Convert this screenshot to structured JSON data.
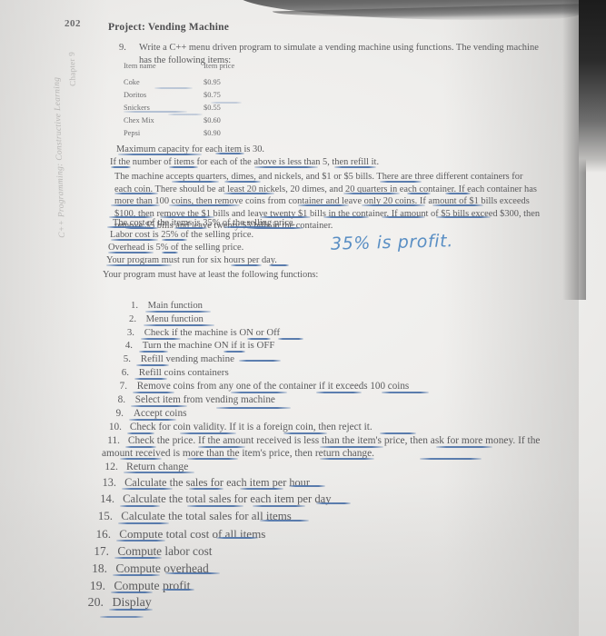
{
  "page": {
    "number": "202",
    "book_margin_text": "C++ Programming: Constructive Learning",
    "chapter_margin_text": "Chapter 9"
  },
  "title": "Project: Vending Machine",
  "question": {
    "number": "9.",
    "text": "Write a C++ menu driven program to simulate a vending machine using functions. The vending machine has the following items:"
  },
  "item_table": {
    "headers": [
      "Item name",
      "Item price"
    ],
    "rows": [
      [
        "Coke",
        "$0.95"
      ],
      [
        "Doritos",
        "$0.75"
      ],
      [
        "Snickers",
        "$0.55"
      ],
      [
        "Chex Mix",
        "$0.60"
      ],
      [
        "Pepsi",
        "$0.90"
      ]
    ]
  },
  "specs": {
    "capacity": "Maximum capacity for each item is 30.",
    "refill_rule": "If the number of items for each of the above is less than 5, then refill it.",
    "machine_rules": "The machine accepts quarters, dimes, and nickels, and $1 or $5 bills. There are three different containers for each coin. There should be at least 20 nickels, 20 dimes, and 20 quarters in each container. If each container has more than 100 coins, then remove coins from container and leave only 20 coins. If amount of $1 bills exceeds $100, then remove the $1 bills and leave twenty $1 bills in the container. If amount of $5 bills exceed $300, then remove $5 bills and leave twenty $5 bills in the container.",
    "cost": "The cost of the items is 35% of the selling price.",
    "labor": "Labor cost is 25% of the selling price.",
    "overhead": "Overhead is 5% of the selling price.",
    "runtime": "Your program must run for six hours per day.",
    "functions_intro": "Your program must have at least the following functions:"
  },
  "handwritten_note": "35% is profit.",
  "functions": [
    {
      "n": "1.",
      "text": "Main function"
    },
    {
      "n": "2.",
      "text": "Menu function"
    },
    {
      "n": "3.",
      "text": "Check if the machine is ON or Off"
    },
    {
      "n": "4.",
      "text": "Turn the machine ON if it is OFF"
    },
    {
      "n": "5.",
      "text": "Refill vending machine"
    },
    {
      "n": "6.",
      "text": "Refill coins containers"
    },
    {
      "n": "7.",
      "text": "Remove coins from any one of the container if it exceeds 100 coins"
    },
    {
      "n": "8.",
      "text": "Select item from vending machine"
    },
    {
      "n": "9.",
      "text": "Accept coins"
    },
    {
      "n": "10.",
      "text": "Check for coin validity. If it is a foreign coin, then reject it."
    },
    {
      "n": "11.",
      "text": "Check the price. If the amount received is less than the item's price, then ask for more money. If the amount received is more than the item's price, then return change."
    },
    {
      "n": "12.",
      "text": "Return change"
    },
    {
      "n": "13.",
      "text": "Calculate the sales for each item per hour"
    },
    {
      "n": "14.",
      "text": "Calculate the total sales for each item per day"
    },
    {
      "n": "15.",
      "text": "Calculate the total sales for all items"
    },
    {
      "n": "16.",
      "text": "Compute total cost of all items"
    },
    {
      "n": "17.",
      "text": "Compute labor cost"
    },
    {
      "n": "18.",
      "text": "Compute overhead"
    },
    {
      "n": "19.",
      "text": "Compute profit"
    },
    {
      "n": "20.",
      "text": "Display"
    }
  ],
  "colors": {
    "ink_underline": "#5c80b0",
    "handwriting": "#5a8fc4",
    "paper": "#efeeec",
    "text": "#5b5b5d"
  }
}
